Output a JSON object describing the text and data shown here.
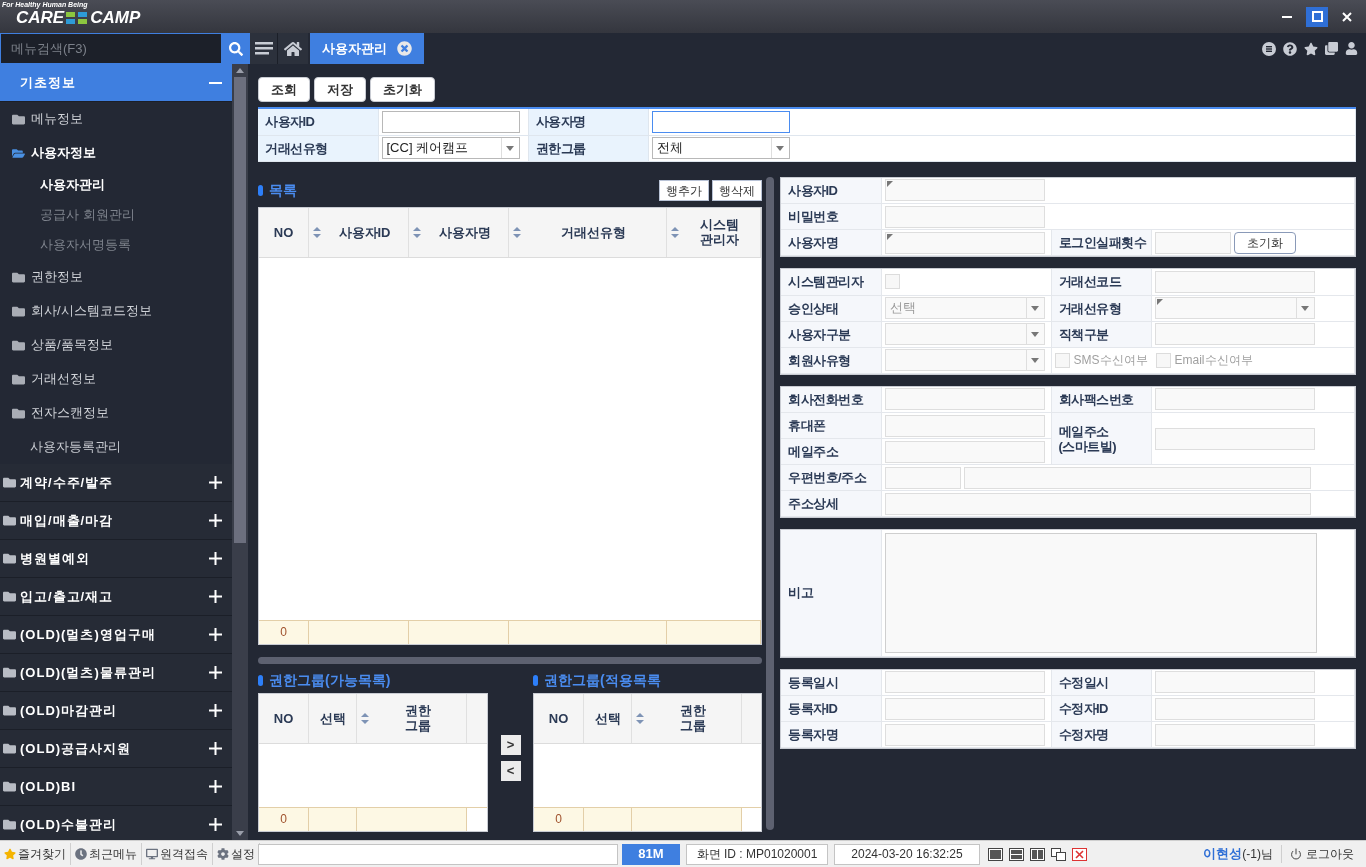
{
  "window": {
    "tagline": "For Healthy Human Being",
    "logo_left": "CARE",
    "logo_right": "CAMP"
  },
  "menu_search": {
    "placeholder": "메뉴검색(F3)"
  },
  "tabs": [
    {
      "label": "사용자관리",
      "selected": true
    }
  ],
  "sidebar": {
    "sections": [
      {
        "label": "기초정보",
        "expanded": true,
        "items": [
          {
            "kind": "folder",
            "label": "메뉴정보",
            "expanded": false
          },
          {
            "kind": "folder",
            "label": "사용자정보",
            "expanded": true,
            "children": [
              {
                "label": "사용자관리",
                "selected": true
              },
              {
                "label": "공급사 회원관리",
                "selected": false
              },
              {
                "label": "사용자서명등록",
                "selected": false
              }
            ]
          },
          {
            "kind": "folder",
            "label": "권한정보",
            "expanded": false
          },
          {
            "kind": "folder",
            "label": "회사/시스템코드정보",
            "expanded": false
          },
          {
            "kind": "folder",
            "label": "상품/품목정보",
            "expanded": false
          },
          {
            "kind": "folder",
            "label": "거래선정보",
            "expanded": false
          },
          {
            "kind": "folder",
            "label": "전자스캔정보",
            "expanded": false
          },
          {
            "kind": "page",
            "label": "사용자등록관리",
            "selected": false
          }
        ]
      },
      {
        "label": "계약/수주/발주",
        "expanded": false
      },
      {
        "label": "매입/매출/마감",
        "expanded": false
      },
      {
        "label": "병원별예외",
        "expanded": false
      },
      {
        "label": "입고/출고/재고",
        "expanded": false
      },
      {
        "label": "(OLD)(멀츠)영업구매",
        "expanded": false
      },
      {
        "label": "(OLD)(멀츠)물류관리",
        "expanded": false
      },
      {
        "label": "(OLD)마감관리",
        "expanded": false
      },
      {
        "label": "(OLD)공급사지원",
        "expanded": false
      },
      {
        "label": "(OLD)BI",
        "expanded": false
      },
      {
        "label": "(OLD)수불관리",
        "expanded": false
      }
    ]
  },
  "toolbar": {
    "buttons": [
      "조회",
      "저장",
      "초기화"
    ]
  },
  "search_form": {
    "rows": [
      {
        "cells": [
          {
            "kind": "label",
            "text": "사용자ID"
          },
          {
            "kind": "controls",
            "items": [
              {
                "kind": "input",
                "focused": false
              }
            ]
          },
          {
            "kind": "label",
            "text": "사용자명"
          },
          {
            "kind": "controls",
            "items": [
              {
                "kind": "input",
                "focused": true
              }
            ]
          }
        ]
      },
      {
        "cells": [
          {
            "kind": "label",
            "text": "거래선유형"
          },
          {
            "kind": "controls",
            "items": [
              {
                "kind": "select",
                "value": "[CC] 케어캠프"
              }
            ]
          },
          {
            "kind": "label",
            "text": "권한그룹"
          },
          {
            "kind": "controls",
            "items": [
              {
                "kind": "select",
                "value": "전체"
              }
            ]
          }
        ]
      }
    ]
  },
  "list": {
    "title": "목록",
    "buttons": [
      "행추가",
      "행삭제"
    ],
    "grid": {
      "columns": [
        {
          "label": "NO",
          "sortable": false
        },
        {
          "label": "사용자ID",
          "sortable": true
        },
        {
          "label": "사용자명",
          "sortable": true
        },
        {
          "label": "거래선유형",
          "sortable": true
        },
        {
          "label": "시스템 관리자",
          "sortable": true
        }
      ],
      "count": "0"
    }
  },
  "group_available": {
    "title": "권한그룹(가능목록)",
    "grid": {
      "columns": [
        {
          "label": "NO",
          "sortable": false
        },
        {
          "label": "선택",
          "sortable": false
        },
        {
          "label": "권한 그룹",
          "sortable": true
        }
      ],
      "count": "0"
    }
  },
  "move_buttons": [
    ">",
    "<"
  ],
  "group_applied": {
    "title": "권한그룹(적용목록",
    "grid": {
      "columns": [
        {
          "label": "NO",
          "sortable": false
        },
        {
          "label": "선택",
          "sortable": false
        },
        {
          "label": "권한 그룹",
          "sortable": true
        }
      ],
      "count": "0"
    }
  },
  "detail_form": {
    "sections": [
      {
        "rows": [
          {
            "cells": [
              {
                "kind": "label",
                "text": "사용자ID"
              },
              {
                "kind": "controls",
                "items": [
                  {
                    "kind": "input",
                    "required": true
                  }
                ]
              }
            ]
          },
          {
            "cells": [
              {
                "kind": "label",
                "text": "비밀번호"
              },
              {
                "kind": "controls",
                "items": [
                  {
                    "kind": "input"
                  }
                ]
              }
            ]
          },
          {
            "cells": [
              {
                "kind": "label",
                "text": "사용자명"
              },
              {
                "kind": "controls",
                "items": [
                  {
                    "kind": "input",
                    "required": true
                  }
                ]
              },
              {
                "kind": "label",
                "text": "로그인실패횟수"
              },
              {
                "kind": "controls",
                "items": [
                  {
                    "kind": "short_input"
                  },
                  {
                    "kind": "button",
                    "label": "초기화"
                  }
                ]
              }
            ]
          }
        ]
      },
      {
        "rows": [
          {
            "cells": [
              {
                "kind": "label",
                "text": "시스템관리자"
              },
              {
                "kind": "controls",
                "items": [
                  {
                    "kind": "checkbox",
                    "checked": false,
                    "disabled": true
                  }
                ]
              },
              {
                "kind": "label",
                "text": "거래선코드"
              },
              {
                "kind": "controls",
                "items": [
                  {
                    "kind": "input"
                  }
                ]
              }
            ]
          },
          {
            "cells": [
              {
                "kind": "label",
                "text": "승인상태"
              },
              {
                "kind": "controls",
                "items": [
                  {
                    "kind": "select",
                    "value": "선택",
                    "disabled": true
                  }
                ]
              },
              {
                "kind": "label",
                "text": "거래선유형"
              },
              {
                "kind": "controls",
                "items": [
                  {
                    "kind": "select",
                    "required": true
                  }
                ]
              }
            ]
          },
          {
            "cells": [
              {
                "kind": "label",
                "text": "사용자구분"
              },
              {
                "kind": "controls",
                "items": [
                  {
                    "kind": "select"
                  }
                ]
              },
              {
                "kind": "label",
                "text": "직책구분"
              },
              {
                "kind": "controls",
                "items": [
                  {
                    "kind": "input"
                  }
                ]
              }
            ]
          },
          {
            "cells": [
              {
                "kind": "label",
                "text": "회원사유형"
              },
              {
                "kind": "controls",
                "items": [
                  {
                    "kind": "select"
                  }
                ]
              },
              {
                "kind": "controls",
                "items": [
                  {
                    "kind": "checkbox",
                    "label": "SMS수신여부",
                    "checked": false,
                    "disabled": true
                  },
                  {
                    "kind": "checkbox",
                    "label": "Email수신여부",
                    "checked": false,
                    "disabled": true
                  }
                ]
              }
            ]
          }
        ]
      },
      {
        "rows": [
          {
            "cells": [
              {
                "kind": "label",
                "text": "회사전화번호"
              },
              {
                "kind": "controls",
                "items": [
                  {
                    "kind": "input"
                  }
                ]
              },
              {
                "kind": "label",
                "text": "회사팩스번호"
              },
              {
                "kind": "controls",
                "items": [
                  {
                    "kind": "input"
                  }
                ]
              }
            ]
          },
          {
            "cells": [
              {
                "kind": "label",
                "text": "휴대폰"
              },
              {
                "kind": "controls",
                "items": [
                  {
                    "kind": "input"
                  }
                ]
              },
              {
                "kind": "label",
                "text": "메일주소 (스마트빌)",
                "rowspan": 2
              },
              {
                "kind": "controls",
                "items": [
                  {
                    "kind": "input"
                  }
                ],
                "rowspan": 2
              }
            ]
          },
          {
            "cells": [
              {
                "kind": "label",
                "text": "메일주소"
              },
              {
                "kind": "controls",
                "items": [
                  {
                    "kind": "input"
                  }
                ]
              }
            ]
          },
          {
            "cells": [
              {
                "kind": "label",
                "text": "우편번호/주소"
              },
              {
                "kind": "controls",
                "items": [
                  {
                    "kind": "short_input"
                  },
                  {
                    "kind": "long_input"
                  }
                ]
              }
            ]
          },
          {
            "cells": [
              {
                "kind": "label",
                "text": "주소상세"
              },
              {
                "kind": "controls",
                "items": [
                  {
                    "kind": "long_input"
                  }
                ]
              }
            ]
          }
        ]
      },
      {
        "rows": [
          {
            "cells": [
              {
                "kind": "label",
                "text": "비고"
              },
              {
                "kind": "controls",
                "items": [
                  {
                    "kind": "textarea"
                  }
                ]
              }
            ]
          }
        ]
      },
      {
        "rows": [
          {
            "cells": [
              {
                "kind": "label",
                "text": "등록일시"
              },
              {
                "kind": "controls",
                "items": [
                  {
                    "kind": "input"
                  }
                ]
              },
              {
                "kind": "label",
                "text": "수정일시"
              },
              {
                "kind": "controls",
                "items": [
                  {
                    "kind": "input"
                  }
                ]
              }
            ]
          },
          {
            "cells": [
              {
                "kind": "label",
                "text": "등록자ID"
              },
              {
                "kind": "controls",
                "items": [
                  {
                    "kind": "input"
                  }
                ]
              },
              {
                "kind": "label",
                "text": "수정자ID"
              },
              {
                "kind": "controls",
                "items": [
                  {
                    "kind": "input"
                  }
                ]
              }
            ]
          },
          {
            "cells": [
              {
                "kind": "label",
                "text": "등록자명"
              },
              {
                "kind": "controls",
                "items": [
                  {
                    "kind": "input"
                  }
                ]
              },
              {
                "kind": "label",
                "text": "수정자명"
              },
              {
                "kind": "controls",
                "items": [
                  {
                    "kind": "input"
                  }
                ]
              }
            ]
          }
        ]
      }
    ]
  },
  "status_bar": {
    "buttons": [
      {
        "kind": "favorites",
        "label": "즐겨찾기"
      },
      {
        "kind": "recent",
        "label": "최근메뉴"
      },
      {
        "kind": "remote",
        "label": "원격접속"
      },
      {
        "kind": "settings",
        "label": "설정"
      }
    ],
    "memory": "81M",
    "screen_id": "화면 ID : MP01020001",
    "datetime": "2024-03-20 16:32:25",
    "user_name": "이현성",
    "user_suffix": "(-1)님",
    "logout": "로그아웃"
  }
}
